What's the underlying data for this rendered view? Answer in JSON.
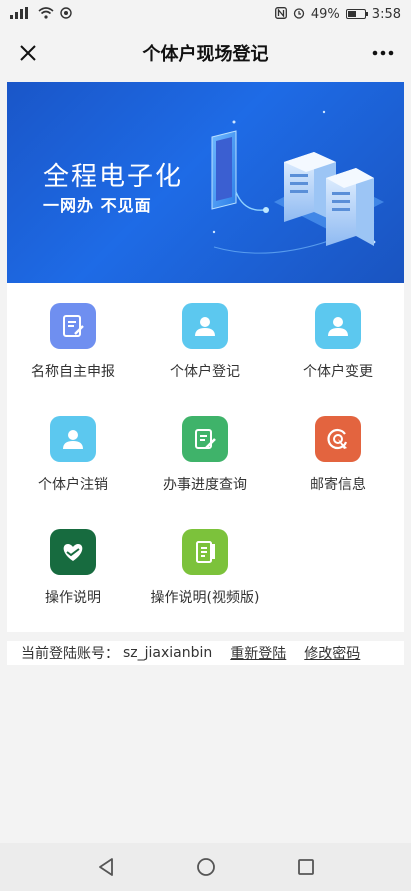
{
  "status_bar": {
    "battery": "49%",
    "time": "3:58",
    "battery_level": 0.49
  },
  "header": {
    "title": "个体户现场登记"
  },
  "banner": {
    "title": "全程电子化",
    "subtitle": "一网办 不见面"
  },
  "grid": [
    {
      "label": "名称自主申报",
      "icon": "form-edit-icon",
      "color": "#6f8ff0"
    },
    {
      "label": "个体户登记",
      "icon": "user-icon",
      "color": "#5cc8ef"
    },
    {
      "label": "个体户变更",
      "icon": "user-icon",
      "color": "#5cc8ef"
    },
    {
      "label": "个体户注销",
      "icon": "user-icon",
      "color": "#5cc8ef"
    },
    {
      "label": "办事进度查询",
      "icon": "edit-doc-icon",
      "color": "#3fb36a"
    },
    {
      "label": "邮寄信息",
      "icon": "cursor-click-icon",
      "color": "#e3643f"
    },
    {
      "label": "操作说明",
      "icon": "heart-hands-icon",
      "color": "#176b3f"
    },
    {
      "label": "操作说明(视频版)",
      "icon": "document-icon",
      "color": "#7cc23b"
    }
  ],
  "account": {
    "label": "当前登陆账号：",
    "username": "sz_jiaxianbin",
    "relogin": "重新登陆",
    "change_password": "修改密码"
  }
}
